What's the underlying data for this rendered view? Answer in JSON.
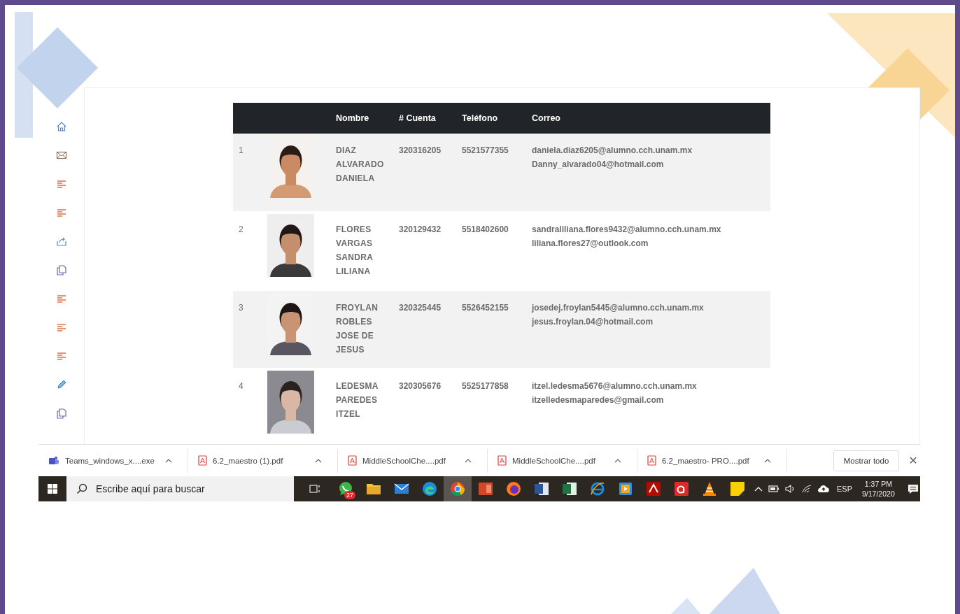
{
  "sidebar": {
    "items": [
      {
        "kind": "home"
      },
      {
        "kind": "mail"
      },
      {
        "kind": "list"
      },
      {
        "kind": "list"
      },
      {
        "kind": "share"
      },
      {
        "kind": "copy"
      },
      {
        "kind": "list"
      },
      {
        "kind": "list"
      },
      {
        "kind": "list"
      },
      {
        "kind": "pencil"
      },
      {
        "kind": "copy"
      }
    ]
  },
  "table": {
    "columns": [
      "Nombre",
      "# Cuenta",
      "Teléfono",
      "Correo"
    ],
    "rows": [
      {
        "number": "1",
        "name": "DIAZ ALVARADO DANIELA",
        "cuenta": "320316205",
        "telefono": "5521577355",
        "emails": [
          "daniela.diaz6205@alumno.cch.unam.mx",
          "Danny_alvarado04@hotmail.com"
        ]
      },
      {
        "number": "2",
        "name": "FLORES VARGAS SANDRA LILIANA",
        "cuenta": "320129432",
        "telefono": "5518402600",
        "emails": [
          "sandraliliana.flores9432@alumno.cch.unam.mx",
          "liliana.flores27@outlook.com"
        ]
      },
      {
        "number": "3",
        "name": "FROYLAN ROBLES JOSE DE JESUS",
        "cuenta": "320325445",
        "telefono": "5526452155",
        "emails": [
          "josedej.froylan5445@alumno.cch.unam.mx",
          "jesus.froylan.04@hotmail.com"
        ]
      },
      {
        "number": "4",
        "name": "LEDESMA PAREDES ITZEL",
        "cuenta": "320305676",
        "telefono": "5525177858",
        "emails": [
          "itzel.ledesma5676@alumno.cch.unam.mx",
          "itzelledesmaparedes@gmail.com"
        ]
      }
    ]
  },
  "downloads": {
    "items": [
      {
        "kind": "teams",
        "name": "Teams_windows_x....exe"
      },
      {
        "kind": "pdf",
        "name": "6.2_maestro (1).pdf"
      },
      {
        "kind": "pdf",
        "name": "MiddleSchoolChe....pdf"
      },
      {
        "kind": "pdf",
        "name": "MiddleSchoolChe....pdf"
      },
      {
        "kind": "pdf",
        "name": "6.2_maestro- PRO....pdf"
      }
    ],
    "show_all": "Mostrar todo",
    "close": "×"
  },
  "taskbar": {
    "search": {
      "placeholder": "Escribe aquí para buscar"
    },
    "apps": [
      {
        "kind": "chat",
        "badge": "27",
        "selected": false
      },
      {
        "kind": "folder",
        "selected": false
      },
      {
        "kind": "mail",
        "selected": false
      },
      {
        "kind": "edge",
        "selected": false
      },
      {
        "kind": "chrome",
        "selected": true
      },
      {
        "kind": "slides",
        "selected": false
      },
      {
        "kind": "firefox",
        "selected": false
      },
      {
        "kind": "word",
        "selected": false
      },
      {
        "kind": "sheet",
        "selected": false
      },
      {
        "kind": "ie",
        "selected": false
      },
      {
        "kind": "player",
        "selected": false
      },
      {
        "kind": "acrobat",
        "selected": false
      },
      {
        "kind": "avira",
        "selected": false
      },
      {
        "kind": "cone",
        "selected": false
      },
      {
        "kind": "note",
        "selected": false
      }
    ],
    "language": "ESP",
    "time": "1:37 PM",
    "date": "9/17/2020"
  }
}
